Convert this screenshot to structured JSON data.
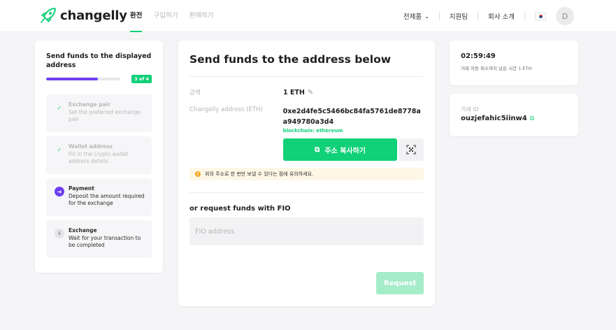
{
  "colors": {
    "accent": "#10d078",
    "progress": "#6d3ff0",
    "warning_bg": "#fef7e6"
  },
  "header": {
    "brand": "changelly",
    "nav": [
      "환전",
      "구입하기",
      "판매하기"
    ],
    "products_label": "전제품",
    "support_label": "지원팀",
    "about_label": "회사 소개",
    "language_icon": "korea-flag-icon",
    "avatar_initial": "D"
  },
  "sidebar": {
    "title": "Send funds to the displayed address",
    "progress": 0.7,
    "progress_badge": "3 of 4",
    "steps": [
      {
        "title": "Exchange pair",
        "desc": "Set the preferred exchange pair",
        "state": "done"
      },
      {
        "title": "Wallet address",
        "desc": "Fill in the crypto wallet address details",
        "state": "done"
      },
      {
        "title": "Payment",
        "desc": "Deposit the amount required for the exchange",
        "state": "current"
      },
      {
        "title": "Exchange",
        "desc": "Wait for your transaction to be completed",
        "state": "todo",
        "number": "4"
      }
    ]
  },
  "main": {
    "title": "Send funds to the address below",
    "amount_label": "금액",
    "amount_value": "1 ETH",
    "address_label": "Changelly address (ETH)",
    "address_value": "0xe2d4fe5c5466bc84fa5761de8778aa949780a3d4",
    "blockchain_text": "blockchain: ethereum",
    "copy_button": "주소 복사하기",
    "warning": "위의 주소로 한 번만 보낼 수 있다는 점에 유의하세요.",
    "fio_title": "or request funds with FIO",
    "fio_placeholder": "FIO address",
    "request_button": "Request"
  },
  "timer": {
    "value": "02:59:49",
    "label": "거래 자동 취소까지 남은 시간 1 ETH"
  },
  "transaction": {
    "label": "거래 ID",
    "value": "ouzjefahic5iinw4"
  }
}
